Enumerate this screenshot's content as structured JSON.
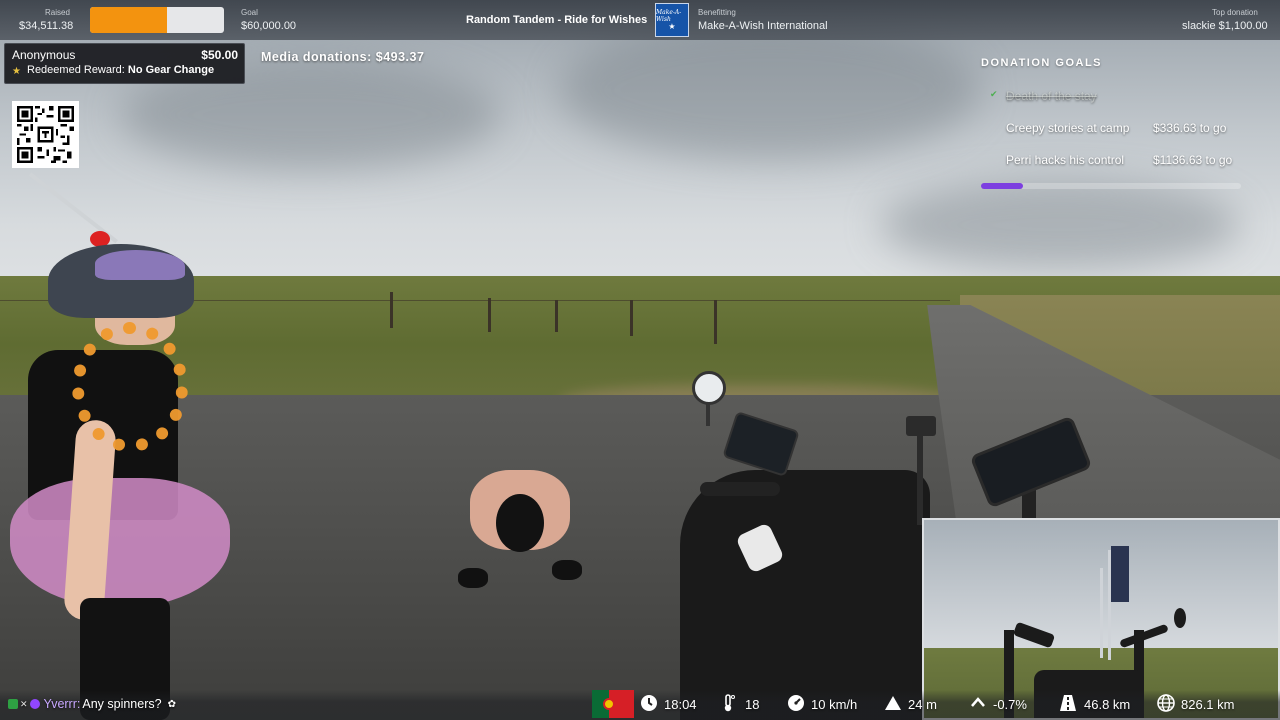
{
  "topbar": {
    "raised_label": "Raised",
    "raised_value": "$34,511.38",
    "raised_progress": 0.575,
    "goal_label": "Goal",
    "goal_value": "$60,000.00",
    "event_title": "Random Tandem - Ride for Wishes",
    "charity_logo_text": "Make-A-Wish",
    "benefitting_label": "Benefitting",
    "benefitting_value": "Make-A-Wish International",
    "top_donation_label": "Top donation",
    "top_donation_value": "slackie $1,100.00"
  },
  "alert": {
    "name": "Anonymous",
    "amount": "$50.00",
    "prefix": "Redeemed Reward: ",
    "reward": "No Gear Change"
  },
  "media_donations": "Media donations: $493.37",
  "donation_goals": {
    "heading": "DONATION GOALS",
    "completed": "Death of the stay",
    "goals": [
      {
        "name": "Creepy stories at camp",
        "amount": "$336.63 to go"
      },
      {
        "name": "Perri hacks his control",
        "amount": "$1136.63 to go"
      }
    ],
    "progress": 0.16,
    "bar_color": "#7d3fe0"
  },
  "chat": {
    "user": "Yverrr:",
    "message": " Any spinners?"
  },
  "stats": {
    "time": "18:04",
    "temperature": "18",
    "speed": "10 km/h",
    "elevation": "24 m",
    "grade": "-0.7%",
    "distance": "46.8 km",
    "total_distance": "826.1 km"
  },
  "icons": {
    "flag": "portugal-flag",
    "time": "clock-icon",
    "temperature": "thermometer-icon",
    "speed": "speedometer-icon",
    "elevation": "mountain-icon",
    "grade": "chevron-up-icon",
    "distance": "road-icon",
    "total_distance": "globe-icon"
  },
  "colors": {
    "progress_fill": "#f3930f",
    "charity_blue": "#1654a8"
  }
}
